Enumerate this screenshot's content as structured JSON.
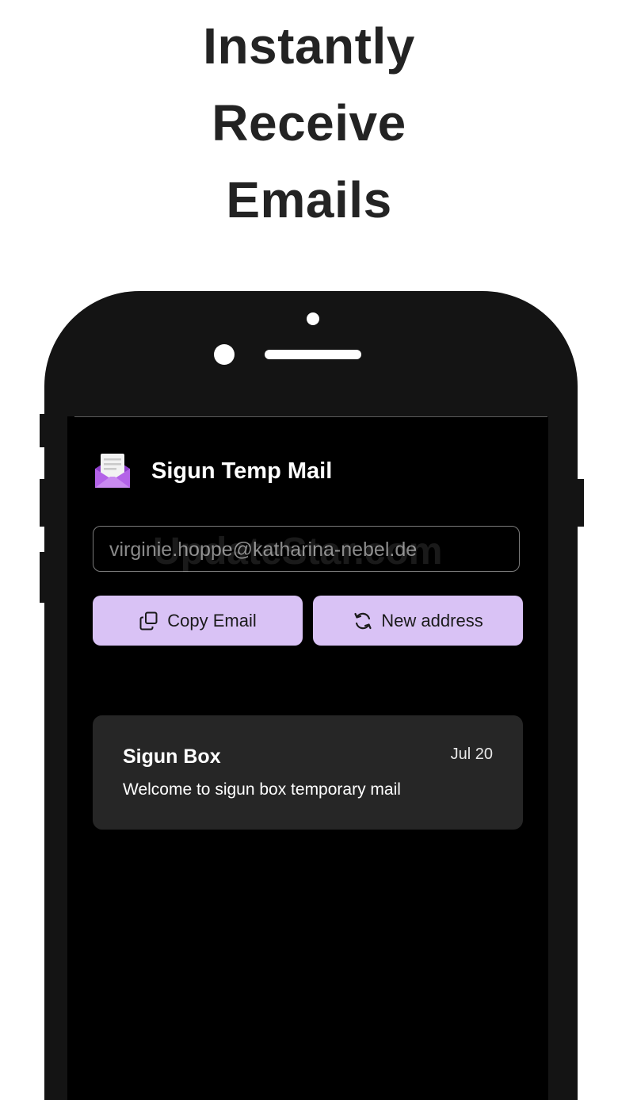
{
  "headline": {
    "line1": "Instantly",
    "line2": "Receive",
    "line3": "Emails"
  },
  "app": {
    "title": "Sigun Temp Mail",
    "logo_icon": "open-envelope-icon"
  },
  "email_field": {
    "value": "virginie.hoppe@katharina-nebel.de"
  },
  "watermark": "UpdateStar.com",
  "actions": {
    "copy_label": "Copy Email",
    "copy_icon": "copy-icon",
    "new_label": "New address",
    "new_icon": "refresh-icon"
  },
  "inbox": [
    {
      "sender": "Sigun Box",
      "date": "Jul 20",
      "preview": "Welcome to sigun box temporary mail"
    }
  ],
  "colors": {
    "accent": "#d9c2f5",
    "card": "#262626",
    "screen": "#000000",
    "phone_body": "#141414",
    "logo_purple": "#b463e8"
  }
}
